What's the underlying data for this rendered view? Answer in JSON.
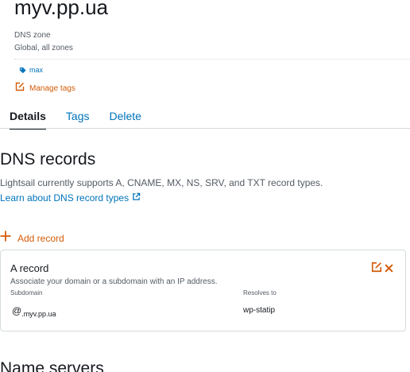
{
  "zone": {
    "title": "myv.pp.ua",
    "type_label": "DNS zone",
    "scope_label": "Global, all zones",
    "tag": "max",
    "manage_tags_label": "Manage tags"
  },
  "tabs": [
    {
      "label": "Details",
      "active": true
    },
    {
      "label": "Tags",
      "active": false
    },
    {
      "label": "Delete",
      "active": false
    }
  ],
  "dns_records": {
    "heading": "DNS records",
    "description": "Lightsail currently supports A, CNAME, MX, NS, SRV, and TXT record types.",
    "learn_link": "Learn about DNS record types",
    "add_label": "Add record",
    "records": [
      {
        "title": "A record",
        "description": "Associate your domain or a subdomain with an IP address.",
        "subdomain_label": "Subdomain",
        "subdomain_at": "@",
        "subdomain_domain": ".myv.pp.ua",
        "resolves_label": "Resolves to",
        "resolves_value": "wp-statip"
      }
    ]
  },
  "name_servers": {
    "heading": "Name servers"
  },
  "colors": {
    "link": "#0073bb",
    "accent": "#d45b07",
    "text": "#16191f",
    "muted": "#545b64",
    "border": "#d5dbdb"
  },
  "icons": {
    "tag": "tag-icon",
    "manage_tags": "edit-icon",
    "external": "external-link-icon",
    "add": "plus-icon",
    "edit": "edit-icon",
    "delete": "close-icon"
  }
}
